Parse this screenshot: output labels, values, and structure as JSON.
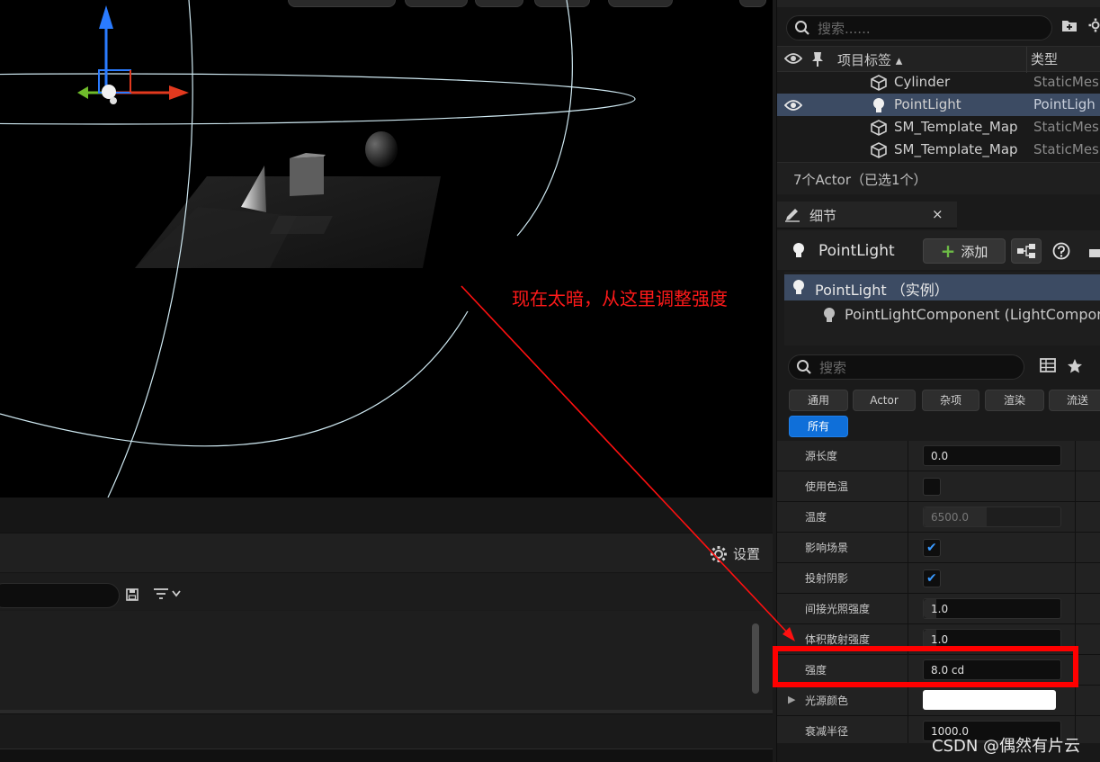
{
  "outliner": {
    "search_placeholder": "搜索......",
    "col_label": "项目标签 ▴",
    "col_type": "类型",
    "rows": [
      {
        "name": "Cylinder",
        "type": "StaticMes"
      },
      {
        "name": "PointLight",
        "type": "PointLigh"
      },
      {
        "name": "SM_Template_Map",
        "type": "StaticMes"
      },
      {
        "name": "SM_Template_Map",
        "type": "StaticMes"
      }
    ],
    "count": "7个Actor（已选1个）"
  },
  "details": {
    "tab_label": "细节",
    "tab_close": "×",
    "actor_name": "PointLight",
    "add_label": "添加",
    "component_instance": "PointLight （实例）",
    "component_child": "PointLightComponent (LightCompon",
    "search_placeholder": "搜索",
    "categories": [
      "通用",
      "Actor",
      "杂项",
      "渲染",
      "流送"
    ],
    "category_all": "所有",
    "properties": [
      {
        "label": "源长度",
        "value": "0.0"
      },
      {
        "label": "使用色温",
        "value": ""
      },
      {
        "label": "温度",
        "value": "6500.0"
      },
      {
        "label": "影响场景",
        "value": ""
      },
      {
        "label": "投射阴影",
        "value": ""
      },
      {
        "label": "间接光照强度",
        "value": "1.0"
      },
      {
        "label": "体积散射强度",
        "value": "1.0"
      },
      {
        "label": "强度",
        "value": "8.0 cd"
      },
      {
        "label": "光源颜色",
        "value": ""
      },
      {
        "label": "衰减半径",
        "value": "1000.0"
      }
    ]
  },
  "lower_panel": {
    "settings_label": "设置"
  },
  "annotation": {
    "text": "现在太暗，从这里调整强度"
  },
  "watermark": "CSDN @偶然有片云",
  "colors": {
    "selection": "#3c4b63",
    "accent": "#0f6fd9",
    "annotation_red": "#ff0000",
    "add_green": "#6dbb46"
  }
}
